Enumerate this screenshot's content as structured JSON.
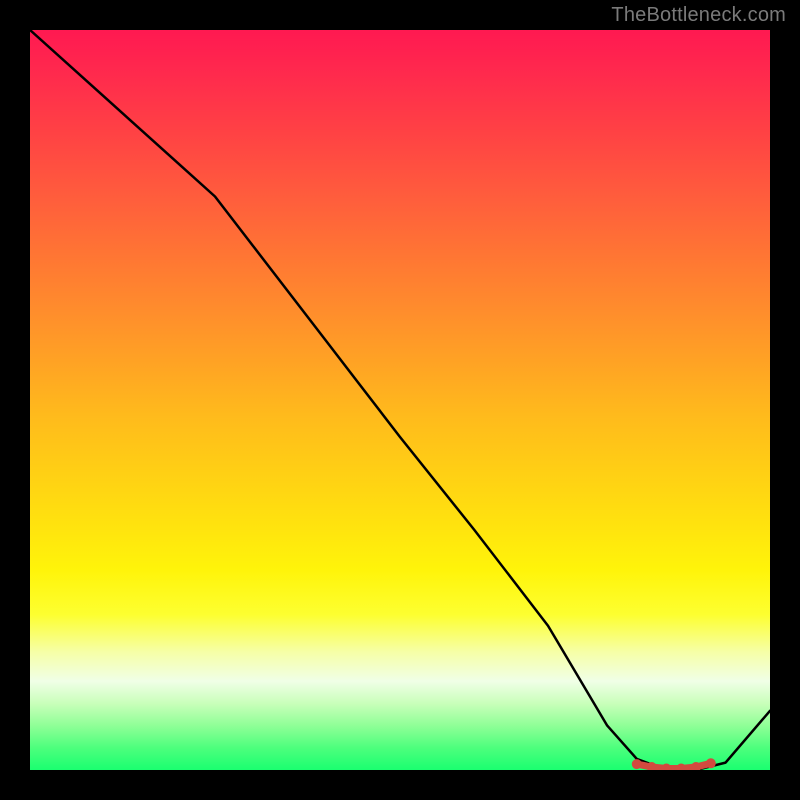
{
  "watermark": "TheBottleneck.com",
  "chart_data": {
    "type": "line",
    "title": "",
    "xlabel": "",
    "ylabel": "",
    "xlim": [
      0,
      100
    ],
    "ylim": [
      0,
      100
    ],
    "grid": false,
    "series": [
      {
        "name": "bottleneck-curve",
        "x": [
          0,
          10,
          20,
          25,
          30,
          40,
          50,
          60,
          70,
          78,
          82,
          86,
          90,
          94,
          100
        ],
        "y": [
          100,
          91,
          82,
          77.5,
          71,
          58,
          45,
          32.5,
          19.5,
          6,
          1.5,
          0,
          0,
          1,
          8
        ]
      }
    ],
    "markers": {
      "name": "recommended-range",
      "x": [
        82,
        84,
        86,
        88,
        90,
        92
      ],
      "y": [
        0.8,
        0.4,
        0.2,
        0.2,
        0.4,
        0.9
      ],
      "color": "#d24a3f"
    },
    "gradient_stops": [
      {
        "pos": 0,
        "color": "#ff1951"
      },
      {
        "pos": 50,
        "color": "#ffc418"
      },
      {
        "pos": 80,
        "color": "#fdff30"
      },
      {
        "pos": 100,
        "color": "#1aff70"
      }
    ]
  }
}
